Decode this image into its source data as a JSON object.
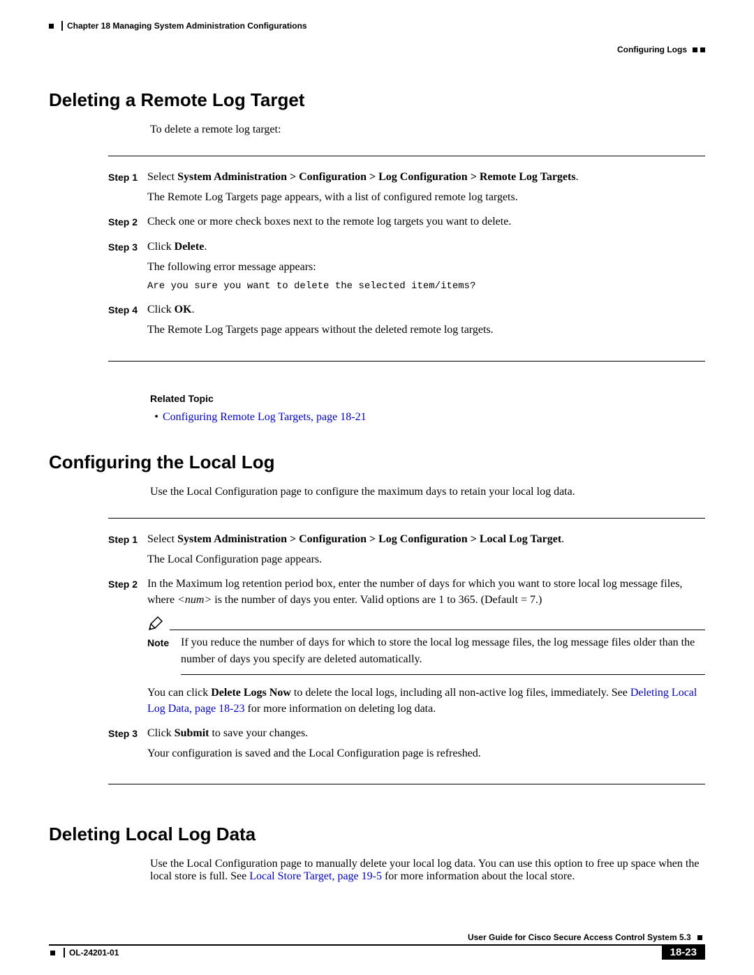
{
  "header": {
    "chapter": "Chapter 18    Managing System Administration Configurations",
    "section": "Configuring Logs"
  },
  "s1": {
    "title": "Deleting a Remote Log Target",
    "intro": "To delete a remote log target:",
    "step1_label": "Step 1",
    "step1_a": "Select ",
    "step1_b": "System Administration > Configuration > Log Configuration > Remote Log Targets",
    "step1_c": ".",
    "step1_d": "The Remote Log Targets page appears, with a list of configured remote log targets.",
    "step2_label": "Step 2",
    "step2_a": "Check one or more check boxes next to the remote log targets you want to delete.",
    "step3_label": "Step 3",
    "step3_a": "Click ",
    "step3_b": "Delete",
    "step3_c": ".",
    "step3_d": "The following error message appears:",
    "step3_e": "Are you sure you want to delete the selected item/items?",
    "step4_label": "Step 4",
    "step4_a": "Click ",
    "step4_b": "OK",
    "step4_c": ".",
    "step4_d": "The Remote Log Targets page appears without the deleted remote log targets.",
    "related_title": "Related Topic",
    "related_link": "Configuring Remote Log Targets, page 18-21"
  },
  "s2": {
    "title": "Configuring the Local Log",
    "intro": "Use the Local Configuration page to configure the maximum days to retain your local log data.",
    "step1_label": "Step 1",
    "step1_a": "Select ",
    "step1_b": "System Administration > Configuration > Log Configuration > Local Log Target",
    "step1_c": ".",
    "step1_d": "The Local Configuration page appears.",
    "step2_label": "Step 2",
    "step2_a": "In the Maximum log retention period box, enter the number of days for which you want to store local log message files, where ",
    "step2_num": "<num>",
    "step2_b": " is the number of days you enter. Valid options are 1 to 365. (Default = 7.)",
    "note_label": "Note",
    "note_text": "If you reduce the number of days for which to store the local log message files, the log message files older than the number of days you specify are deleted automatically.",
    "step2_c": "You can click ",
    "step2_d": "Delete Logs Now",
    "step2_e": " to delete the local logs, including all non-active log files, immediately. See ",
    "step2_link": "Deleting Local Log Data, page 18-23",
    "step2_f": " for more information on deleting log data.",
    "step3_label": "Step 3",
    "step3_a": "Click ",
    "step3_b": "Submit",
    "step3_c": " to save your changes.",
    "step3_d": "Your configuration is saved and the Local Configuration page is refreshed."
  },
  "s3": {
    "title": "Deleting Local Log Data",
    "intro_a": "Use the Local Configuration page to manually delete your local log data. You can use this option to free up space when the local store is full. See ",
    "intro_link": "Local Store Target, page 19-5",
    "intro_b": " for more information about the local store."
  },
  "footer": {
    "guide": "User Guide for Cisco Secure Access Control System 5.3",
    "doc_no": "OL-24201-01",
    "page_no": "18-23"
  }
}
